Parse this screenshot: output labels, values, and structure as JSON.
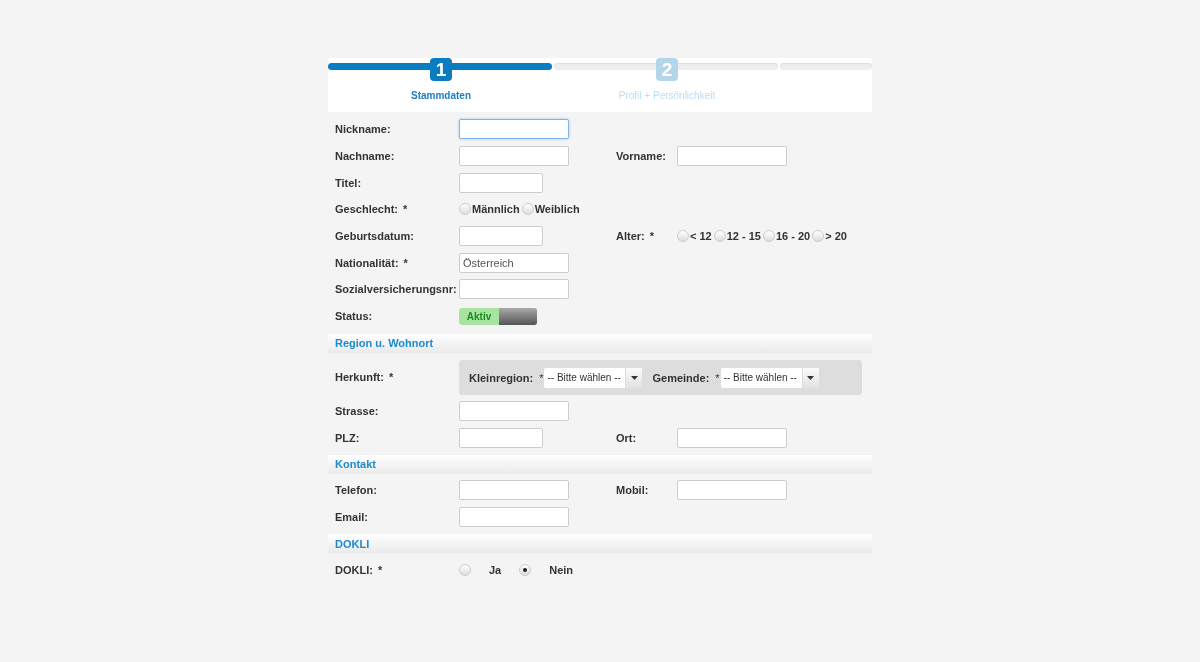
{
  "steps": [
    {
      "number": "1",
      "label": "Stammdaten",
      "selected": true
    },
    {
      "number": "2",
      "label": "Profil + Persönlichkeit",
      "selected": false
    }
  ],
  "sections": [
    {
      "rows": [
        {
          "fields": [
            {
              "label": "Nickname:",
              "kind": "text",
              "focused": true
            }
          ]
        },
        {
          "fields": [
            {
              "label": "Nachname:",
              "kind": "text"
            },
            {
              "label": "Vorname:",
              "kind": "text"
            }
          ]
        },
        {
          "fields": [
            {
              "label": "Titel:",
              "kind": "short_text"
            }
          ]
        },
        {
          "fields": [
            {
              "label": "Geschlecht:",
              "mark": "*",
              "kind": "radio",
              "options": [
                {
                  "label": "Männlich",
                  "selected": false
                },
                {
                  "label": "Weiblich",
                  "selected": false
                }
              ]
            }
          ]
        },
        {
          "fields": [
            {
              "label": "Geburtsdatum:",
              "kind": "short_text"
            },
            {
              "label": "Alter:",
              "mark": "*",
              "kind": "radio",
              "options": [
                {
                  "label": "< 12",
                  "selected": false
                },
                {
                  "label": "12 - 15",
                  "selected": false
                },
                {
                  "label": "16 - 20",
                  "selected": false
                },
                {
                  "label": "> 20",
                  "selected": false
                }
              ]
            }
          ]
        },
        {
          "fields": [
            {
              "label": "Nationalität:",
              "mark": "*",
              "kind": "text",
              "value": "Österreich"
            }
          ]
        },
        {
          "fields": [
            {
              "label": "Sozialversicherungsnr:",
              "kind": "text"
            }
          ]
        },
        {
          "fields": [
            {
              "label": "Status:",
              "kind": "toggle",
              "on": true,
              "text": "Aktiv"
            }
          ]
        }
      ]
    },
    {
      "title": "Region u. Wohnort",
      "rows": [
        {
          "fields": [
            {
              "label": "Herkunft:",
              "mark": "*",
              "kind": "select_group",
              "selects": [
                {
                  "label": "Kleinregion:",
                  "mark": "*",
                  "value": "-- Bitte wählen --"
                },
                {
                  "label": "Gemeinde:",
                  "mark": "*",
                  "value": "-- Bitte wählen --"
                }
              ]
            }
          ]
        },
        {
          "fields": [
            {
              "label": "Strasse:",
              "kind": "text"
            }
          ]
        },
        {
          "fields": [
            {
              "label": "PLZ:",
              "kind": "short_text"
            },
            {
              "label": "Ort:",
              "kind": "text"
            }
          ]
        }
      ]
    },
    {
      "title": "Kontakt",
      "rows": [
        {
          "fields": [
            {
              "label": "Telefon:",
              "kind": "text"
            },
            {
              "label": "Mobil:",
              "kind": "text"
            }
          ]
        },
        {
          "fields": [
            {
              "label": "Email:",
              "kind": "text"
            }
          ]
        }
      ]
    },
    {
      "title": "DOKLI",
      "rows": [
        {
          "fields": [
            {
              "label": "DOKLI:",
              "mark": "*",
              "kind": "radio_spaced",
              "options": [
                {
                  "label": "Ja",
                  "selected": false
                },
                {
                  "label": "Nein",
                  "selected": true
                }
              ]
            }
          ]
        }
      ]
    }
  ]
}
